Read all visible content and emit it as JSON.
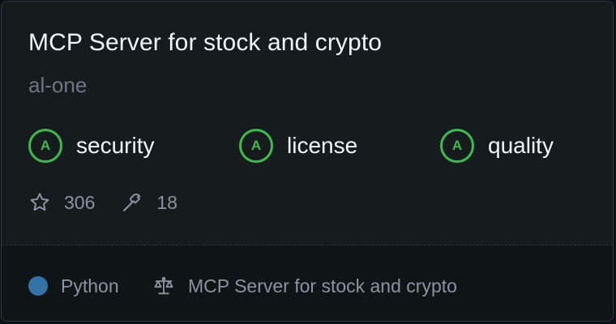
{
  "card": {
    "title": "MCP Server for stock and crypto",
    "owner": "al-one",
    "badges": [
      {
        "grade": "A",
        "label": "security"
      },
      {
        "grade": "A",
        "label": "license"
      },
      {
        "grade": "A",
        "label": "quality"
      }
    ],
    "stats": {
      "stars": "306",
      "forks": "18"
    },
    "footer": {
      "language": "Python",
      "language_color": "#3572a5",
      "license_text": "MCP Server for stock and crypto"
    }
  },
  "colors": {
    "grade_green": "#3fb950",
    "background": "#161b1e"
  },
  "icons": {
    "stars": "star-icon",
    "forks": "hammer-icon",
    "license": "scale-icon"
  }
}
